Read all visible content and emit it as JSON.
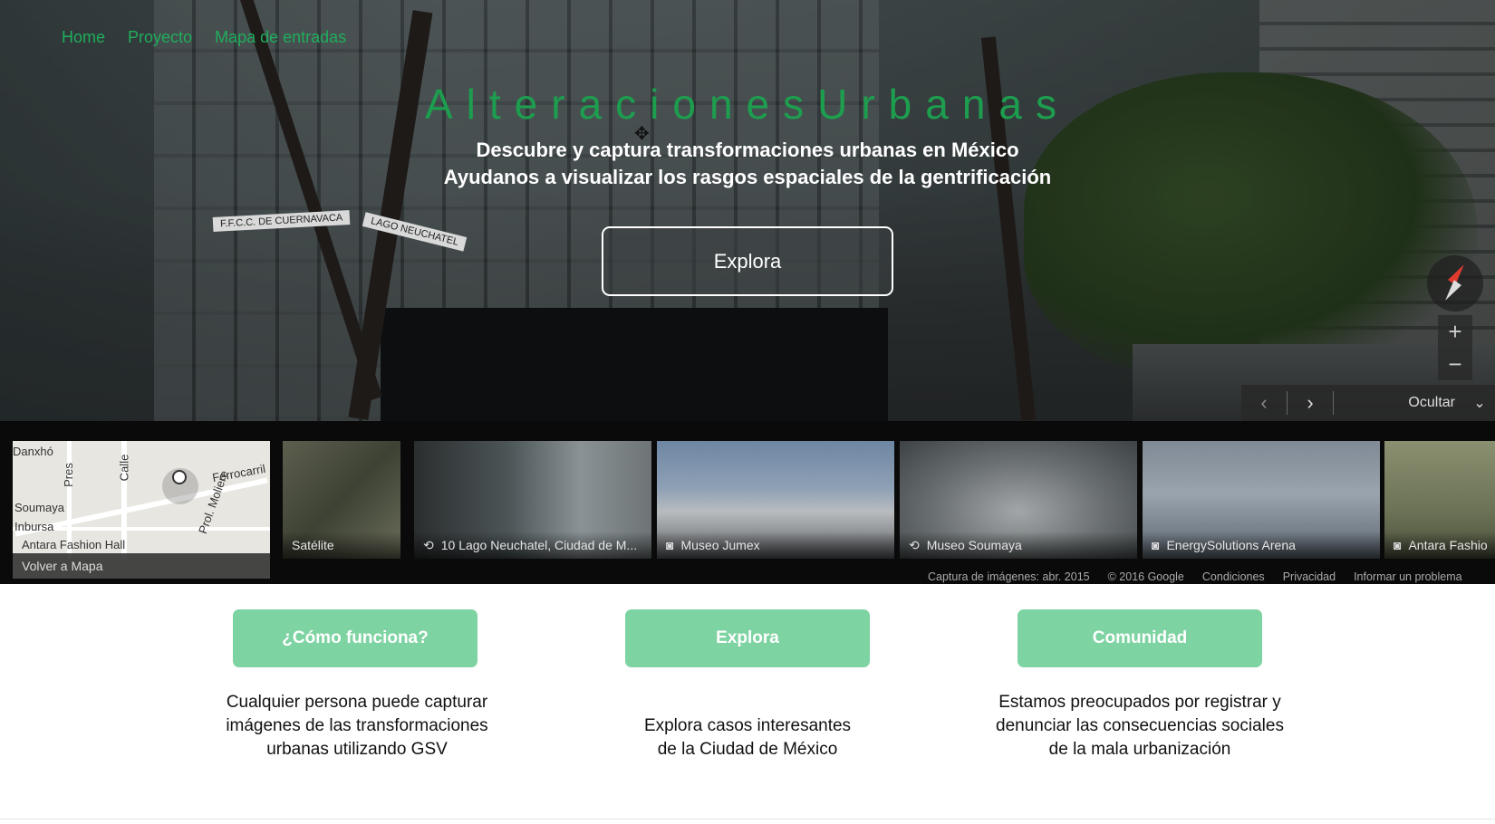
{
  "nav": {
    "home": "Home",
    "proyecto": "Proyecto",
    "mapa": "Mapa de entradas"
  },
  "hero": {
    "title": "AlteracionesUrbanas",
    "subtitle_line1": "Descubre y captura transformaciones urbanas en México",
    "subtitle_line2": "Ayudanos a visualizar los rasgos espaciales de la gentrificación",
    "cta_label": "Explora"
  },
  "streetview": {
    "signs": [
      "F.F.C.C. DE CUERNAVACA",
      "LAGO NEUCHATEL"
    ],
    "zoom_in": "+",
    "zoom_out": "−",
    "hide_label": "Ocultar",
    "minimap": {
      "labels": [
        "Danxhó",
        "Pres",
        "Calle",
        "Ferrocarril",
        "Prol. Moliere",
        "Soumaya",
        "Inbursa",
        "Antara Fashion Hall"
      ],
      "back_label": "Volver a Mapa"
    },
    "thumbnails": [
      {
        "label": "Satélite",
        "icon": "none"
      },
      {
        "label": "10 Lago Neuchatel, Ciudad de M...",
        "icon": "360-icon"
      },
      {
        "label": "Museo Jumex",
        "icon": "camera-icon"
      },
      {
        "label": "Museo Soumaya",
        "icon": "360-icon"
      },
      {
        "label": "EnergySolutions Arena",
        "icon": "camera-icon"
      },
      {
        "label": "Antara Fashio",
        "icon": "camera-icon"
      }
    ],
    "legal": [
      "Captura de imágenes: abr. 2015",
      "© 2016 Google",
      "Condiciones",
      "Privacidad",
      "Informar un problema"
    ]
  },
  "features": [
    {
      "button": "¿Cómo funciona?",
      "text": "Cualquier persona puede capturar imágenes de las transformaciones urbanas utilizando GSV"
    },
    {
      "button": "Explora",
      "text": "Explora casos interesantes de la Ciudad de México"
    },
    {
      "button": "Comunidad",
      "text": "Estamos preocupados por registrar y denunciar las consecuencias sociales de la mala urbanización"
    }
  ],
  "colors": {
    "accent_green": "#1d9e4f",
    "button_green": "#7dd3a1"
  }
}
